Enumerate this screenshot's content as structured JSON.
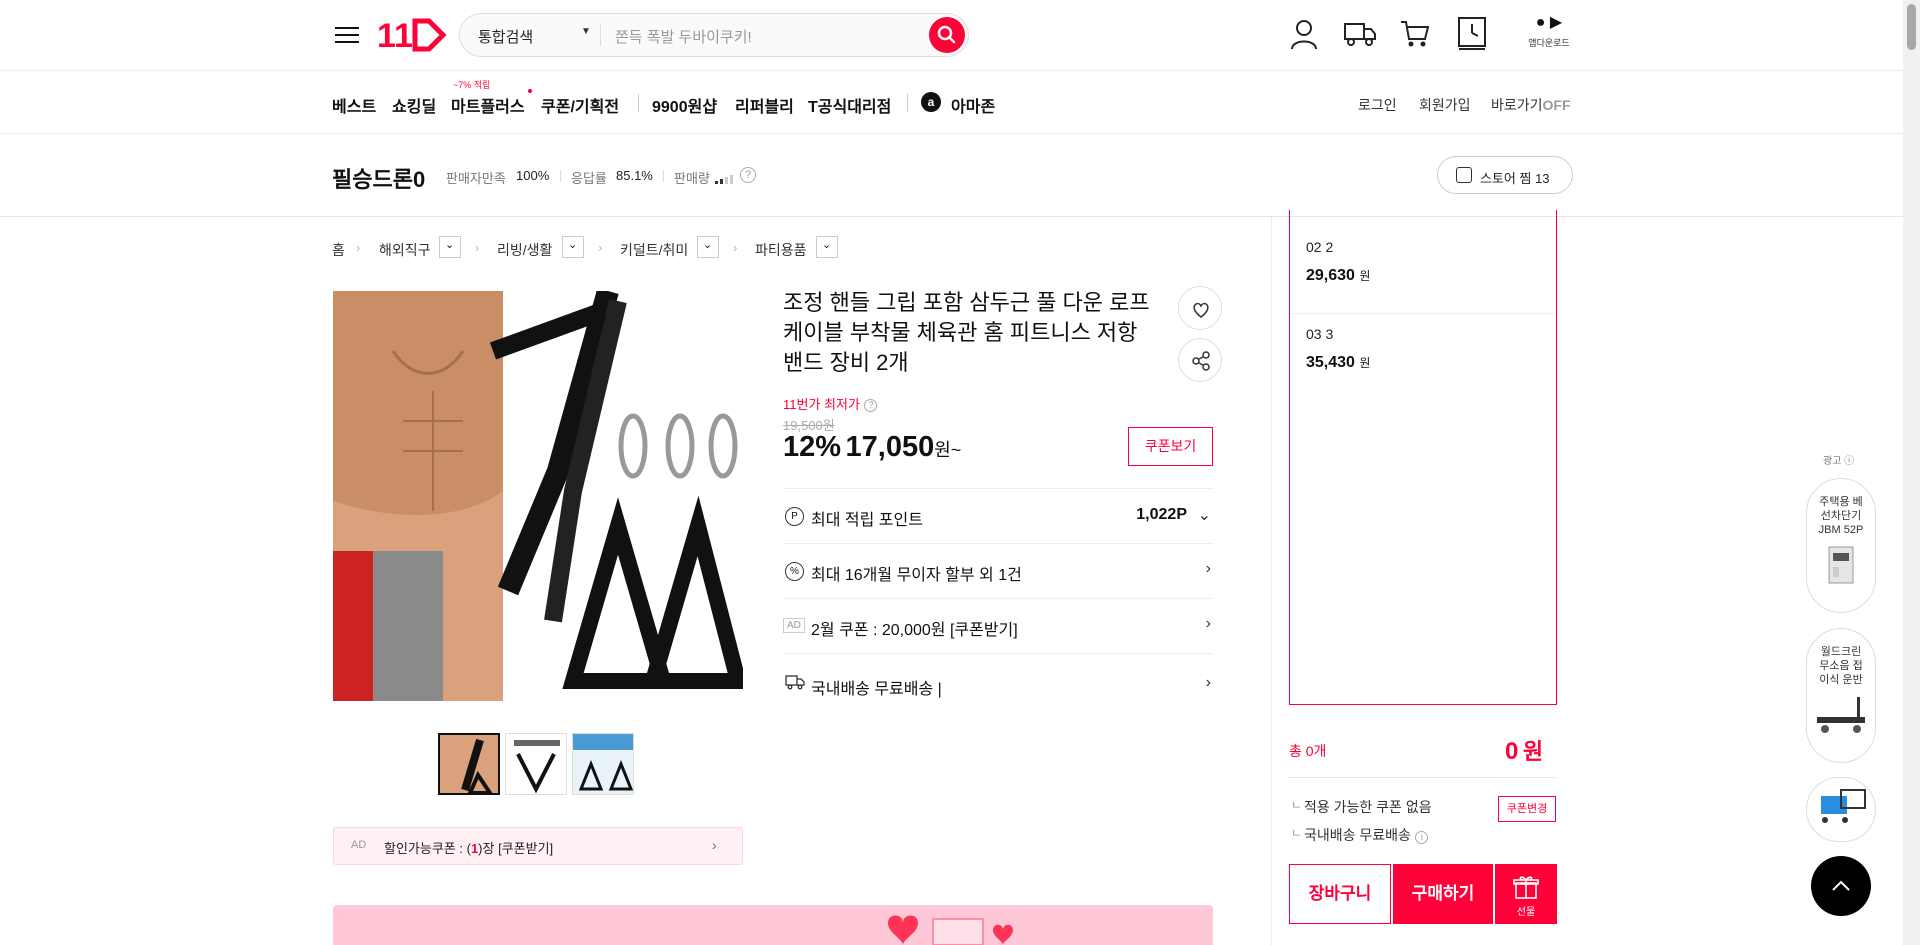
{
  "header": {
    "search_category": "통합검색",
    "search_placeholder": "쫀득 폭발 두바이쿠키!",
    "app_download": "앱다운로드"
  },
  "gnb": {
    "items": [
      "베스트",
      "쇼킹딜",
      "마트플러스",
      "쿠폰/기획전",
      "9900원샵",
      "리퍼블리",
      "T공식대리점",
      "아마존"
    ],
    "mart_badge": "~7% 적립",
    "utils": [
      "로그인",
      "회원가입",
      "바로가기"
    ],
    "shortcut_state": "OFF"
  },
  "seller": {
    "name": "필승드론0",
    "satisfaction_label": "판매자만족",
    "satisfaction_value": "100%",
    "response_label": "응답률",
    "response_value": "85.1%",
    "sales_label": "판매량",
    "store_fav": "스토어 찜 13"
  },
  "breadcrumb": [
    "홈",
    "해외직구",
    "리빙/생활",
    "키덜트/취미",
    "파티용품"
  ],
  "product": {
    "title": "조정 핸들 그립 포함 삼두근 풀 다운 로프 케이블 부착물 체육관 홈 피트니스 저항 밴드 장비 2개",
    "lowest_label": "11번가 최저가",
    "original_price": "19,500원",
    "discount": "12%",
    "price": "17,050",
    "price_unit": "원~",
    "coupon_btn": "쿠폰보기",
    "rows": [
      {
        "label": "최대 적립 포인트",
        "value": "1,022P",
        "icon": "P"
      },
      {
        "label": "최대 16개월 무이자 할부 외 1건",
        "icon": "%"
      },
      {
        "label": "2월 쿠폰 : 20,000원 [쿠폰받기]",
        "icon": "AD"
      },
      {
        "label": "국내배송 무료배송 |",
        "icon": "truck"
      }
    ],
    "ad_coupon_prefix": "AD",
    "ad_coupon_text": "할인가능쿠폰 : (",
    "ad_coupon_count": "1",
    "ad_coupon_suffix": ")장 [쿠폰받기]"
  },
  "options": [
    {
      "name": "02 2",
      "price": "29,630",
      "unit": "원"
    },
    {
      "name": "03 3",
      "price": "35,430",
      "unit": "원"
    }
  ],
  "order": {
    "total_label": "총 0개",
    "total_price": "0",
    "total_unit": "원",
    "coupon_none": "적용 가능한 쿠폰 없음",
    "coupon_change": "쿠폰변경",
    "shipping": "국내배송 무료배송",
    "cart_btn": "장바구니",
    "buy_btn": "구매하기",
    "gift_btn": "선물"
  },
  "side_ads": {
    "ad_label": "광고",
    "items": [
      "주택용 베선차단기 JBM 52P",
      "월드크린 무소음 접이식 운반"
    ]
  },
  "colors": {
    "accent": "#ff0038",
    "text": "#111111"
  }
}
